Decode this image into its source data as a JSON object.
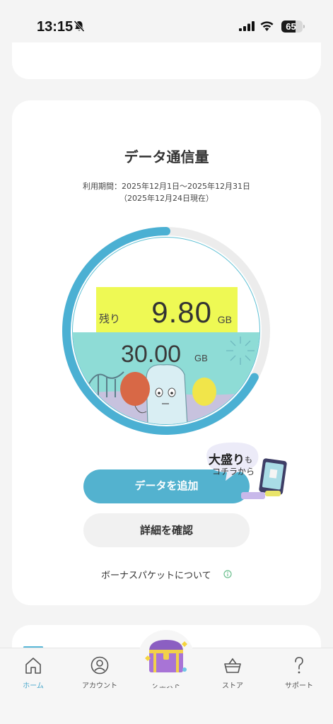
{
  "status_bar": {
    "time": "13:15",
    "battery_percent": 65,
    "icons": [
      "bell-off-icon",
      "signal-icon",
      "wifi-icon",
      "battery-icon"
    ]
  },
  "usage_card": {
    "title": "データ通信量",
    "period": "利用期間：2025年12月1日〜2025年12月31日",
    "as_of": "（2025年12月24日現在）",
    "remaining_label": "残り",
    "remaining_value": "9.80",
    "remaining_unit": "GB",
    "total_value": "30.00",
    "total_unit": "GB",
    "used_fraction": 0.673,
    "colors": {
      "ring": "#4bb0d3",
      "ring_track": "#ececec",
      "water": "#8edcd6",
      "highlight": "#eef954"
    }
  },
  "actions": {
    "add_data": "データを追加",
    "details": "詳細を確認",
    "bonus_link": "ボーナスパケットについて"
  },
  "promo": {
    "big": "大盛り",
    "suffix": "も",
    "line2": "コチラから"
  },
  "tab_bar": {
    "tabs": [
      {
        "label": "ホーム",
        "icon": "home-icon",
        "active": true
      },
      {
        "label": "アカウント",
        "icon": "account-icon",
        "active": false
      },
      {
        "label": "クエスト",
        "icon": "treasure-chest-icon",
        "active": false
      },
      {
        "label": "ストア",
        "icon": "shopping-basket-icon",
        "active": false
      },
      {
        "label": "サポート",
        "icon": "question-mark-icon",
        "active": false
      }
    ]
  }
}
